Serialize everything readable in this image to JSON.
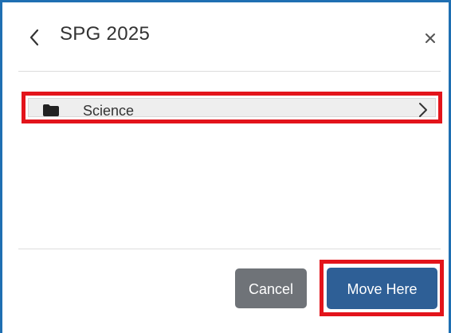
{
  "dialog": {
    "title": "SPG 2025",
    "back_icon": "chevron-left-icon",
    "close_icon": "close-icon"
  },
  "folders": [
    {
      "label": "Science",
      "icon": "folder-icon",
      "chevron": "chevron-right-icon"
    }
  ],
  "footer": {
    "cancel_label": "Cancel",
    "move_label": "Move Here"
  },
  "colors": {
    "frame_border": "#1f6fb2",
    "highlight": "#e3141b",
    "cancel_bg": "#6f7378",
    "move_bg": "#2e5f96",
    "row_bg": "#eeeeee"
  }
}
